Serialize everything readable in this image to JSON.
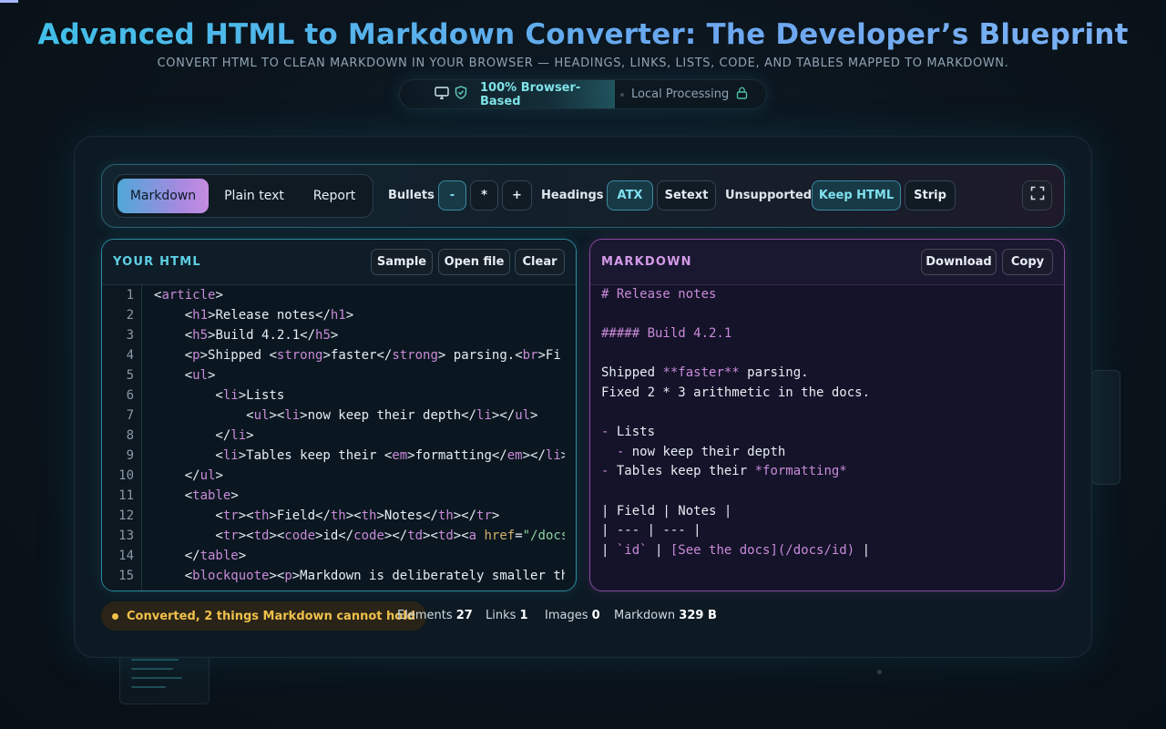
{
  "header": {
    "title": "Advanced HTML to Markdown Converter: The Developer’s Blueprint",
    "subtitle": "CONVERT HTML TO CLEAN MARKDOWN IN YOUR BROWSER — HEADINGS, LINKS, LISTS, CODE, AND TABLES MAPPED TO MARKDOWN.",
    "badge_primary": "100% Browser-Based",
    "badge_secondary": "Local Processing"
  },
  "toolbar": {
    "modes": [
      "Markdown",
      "Plain text",
      "Report"
    ],
    "active_mode": "Markdown",
    "bullets_label": "Bullets",
    "bullets": [
      "-",
      "*",
      "+"
    ],
    "active_bullet": "-",
    "headings_label": "Headings",
    "headings": [
      "ATX",
      "Setext"
    ],
    "active_heading": "ATX",
    "unsupported_label": "Unsupported",
    "unsupported": [
      "Keep HTML",
      "Strip"
    ],
    "active_unsupported": "Keep HTML"
  },
  "html_panel": {
    "title": "YOUR HTML",
    "buttons": [
      "Sample",
      "Open file",
      "Clear"
    ],
    "line_numbers": [
      "1",
      "2",
      "3",
      "4",
      "5",
      "6",
      "7",
      "8",
      "9",
      "10",
      "11",
      "12",
      "13",
      "14",
      "15"
    ],
    "lines": [
      "<article>",
      "    <h1>Release notes</h1>",
      "    <h5>Build 4.2.1</h5>",
      "    <p>Shipped <strong>faster</strong> parsing.<br>Fi",
      "    <ul>",
      "        <li>Lists",
      "            <ul><li>now keep their depth</li></ul>",
      "        </li>",
      "        <li>Tables keep their <em>formatting</em></li>",
      "    </ul>",
      "    <table>",
      "        <tr><th>Field</th><th>Notes</th></tr>",
      "        <tr><td><code>id</code></td><td><a href=\"/docs",
      "    </table>",
      "    <blockquote><p>Markdown is deliberately smaller th"
    ]
  },
  "md_panel": {
    "title": "MARKDOWN",
    "buttons": [
      "Download",
      "Copy"
    ],
    "lines": [
      "# Release notes",
      "",
      "##### Build 4.2.1",
      "",
      "Shipped **faster** parsing.",
      "Fixed 2 * 3 arithmetic in the docs.",
      "",
      "- Lists",
      "  - now keep their depth",
      "- Tables keep their *formatting*",
      "",
      "| Field | Notes |",
      "| --- | --- |",
      "| `id` | [See the docs](/docs/id) |"
    ]
  },
  "status": {
    "message": "Converted, 2 things Markdown cannot hold",
    "elements_label": "Elements",
    "elements_value": "27",
    "links_label": "Links",
    "links_value": "1",
    "images_label": "Images",
    "images_value": "0",
    "markdown_label": "Markdown",
    "markdown_value": "329 B"
  },
  "icons": {
    "monitor": "monitor-icon",
    "shield": "shield-check-icon",
    "lock": "lock-icon",
    "fullscreen": "fullscreen-icon"
  },
  "colors": {
    "accent_cyan": "#5fd0e6",
    "accent_purple": "#d49ae8",
    "status_warning": "#f0c04a"
  }
}
